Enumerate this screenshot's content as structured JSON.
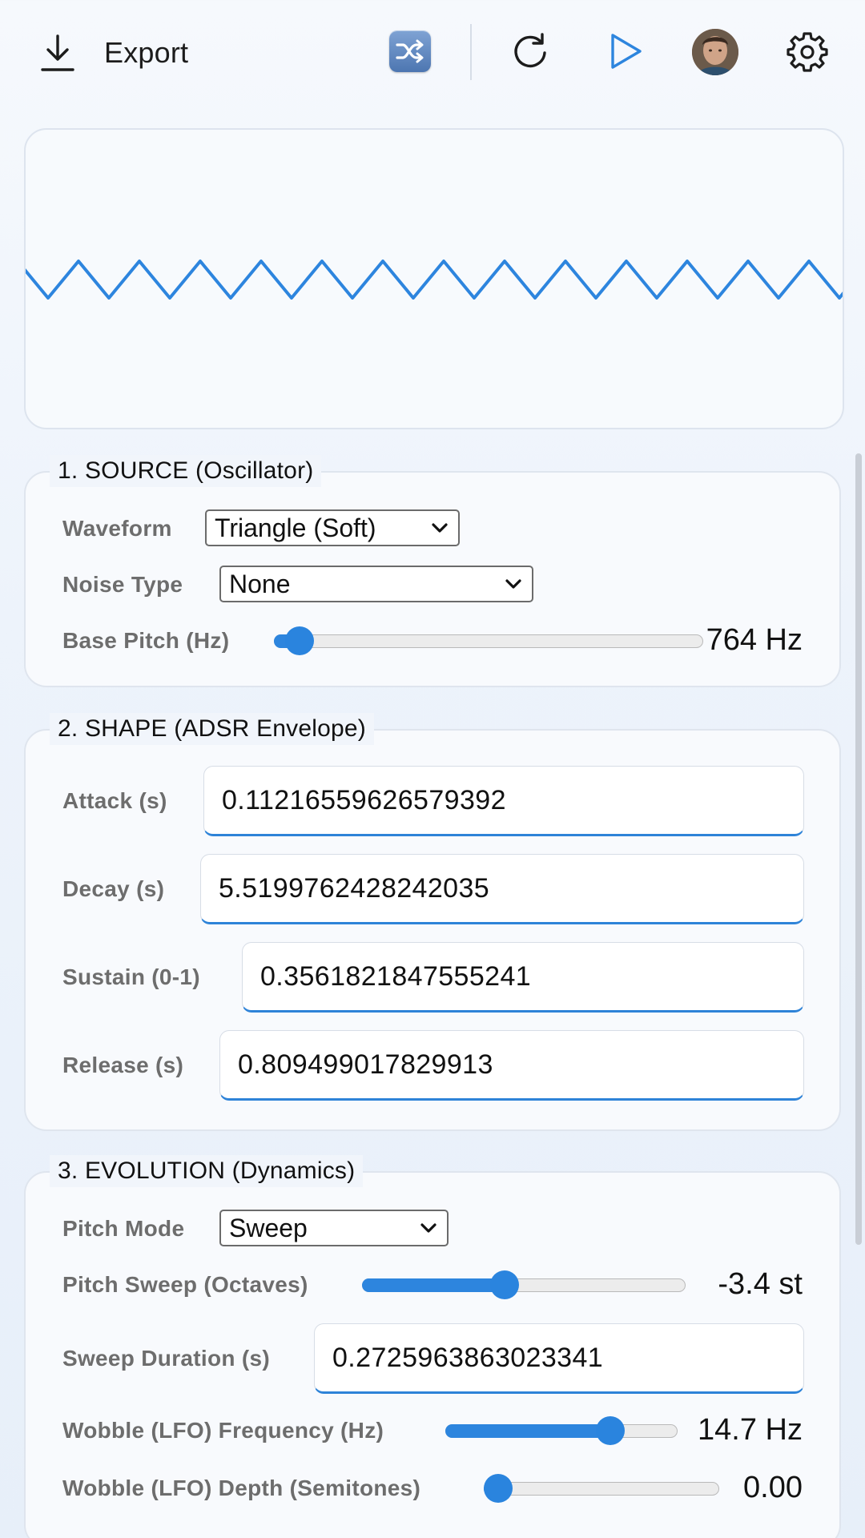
{
  "toolbar": {
    "export_label": "Export",
    "icons": [
      "download-icon",
      "shuffle-icon",
      "refresh-icon",
      "play-icon",
      "avatar",
      "gear-icon"
    ],
    "accent_color": "#2d85de"
  },
  "waveform": {
    "color": "#2d85de",
    "shape": "triangle"
  },
  "source": {
    "title": "1. SOURCE (Oscillator)",
    "waveform_label": "Waveform",
    "waveform_value": "Triangle (Soft)",
    "noise_label": "Noise Type",
    "noise_value": "None",
    "pitch_label": "Base Pitch (Hz)",
    "pitch_value": "764 Hz",
    "pitch_level": 0.06
  },
  "shape": {
    "title": "2. SHAPE (ADSR Envelope)",
    "attack_label": "Attack (s)",
    "attack_value": "0.11216559626579392",
    "decay_label": "Decay (s)",
    "decay_value": "5.5199762428242035",
    "sustain_label": "Sustain (0-1)",
    "sustain_value": "0.3561821847555241",
    "release_label": "Release (s)",
    "release_value": "0.809499017829913"
  },
  "evolution": {
    "title": "3. EVOLUTION (Dynamics)",
    "pitch_mode_label": "Pitch Mode",
    "pitch_mode_value": "Sweep",
    "sweep_label": "Pitch Sweep (Octaves)",
    "sweep_value": "-3.4 st",
    "sweep_level": 0.44,
    "duration_label": "Sweep Duration (s)",
    "duration_value": "0.2725963863023341",
    "lfo_freq_label": "Wobble (LFO) Frequency (Hz)",
    "lfo_freq_value": "14.7 Hz",
    "lfo_freq_level": 0.71,
    "lfo_depth_label": "Wobble (LFO) Depth (Semitones)",
    "lfo_depth_value": "0.00",
    "lfo_depth_level": 0.0
  }
}
